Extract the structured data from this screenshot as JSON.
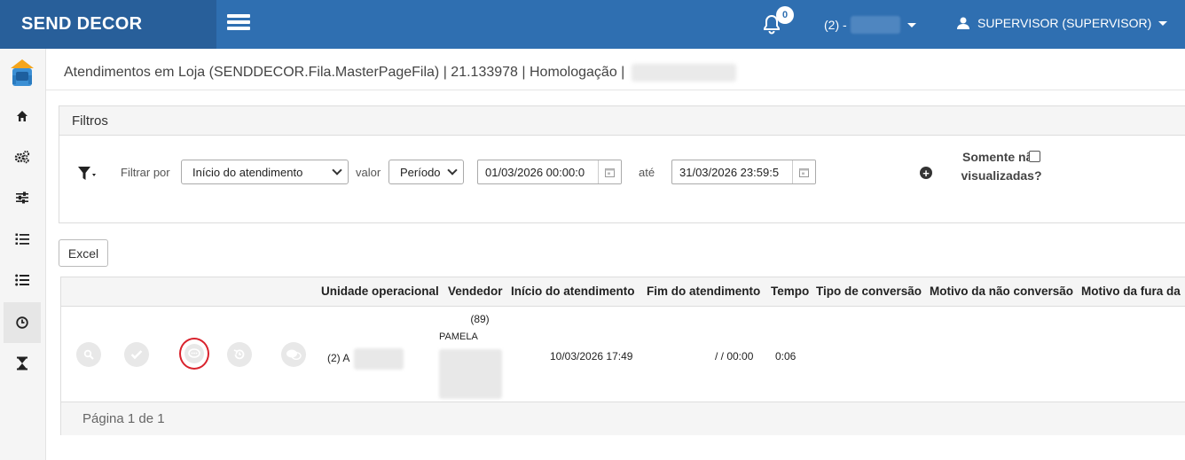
{
  "header": {
    "brand": "SEND DECOR",
    "notifications_count": "0",
    "unit_prefix": "(2) -",
    "user_label": "SUPERVISOR (SUPERVISOR)"
  },
  "page": {
    "title": "Atendimentos em Loja (SENDDECOR.Fila.MasterPageFila) | 21.133978 | Homologação |"
  },
  "filters": {
    "panel_title": "Filtros",
    "filter_by_label": "Filtrar por",
    "filter_by_value": "Início do atendimento",
    "value_label": "valor",
    "value_select": "Período",
    "date_from": "01/03/2026 00:00:0",
    "until_label": "até",
    "date_to": "31/03/2026 23:59:5",
    "only_unviewed_label": "Somente não visualizadas?"
  },
  "toolbar": {
    "excel_label": "Excel"
  },
  "table": {
    "columns": [
      "Unidade operacional",
      "Vendedor",
      "Início do atendimento",
      "Fim do atendimento",
      "Tempo",
      "Tipo de conversão",
      "Motivo da não conversão",
      "Motivo da fura da"
    ],
    "rows": [
      {
        "unidade": "(2) A",
        "vendedor_code": "(89)",
        "vendedor_name": "PAMELA",
        "inicio": "10/03/2026 17:49",
        "fim": "/ / 00:00",
        "tempo": "0:06"
      }
    ],
    "pagination": "Página 1 de 1"
  }
}
